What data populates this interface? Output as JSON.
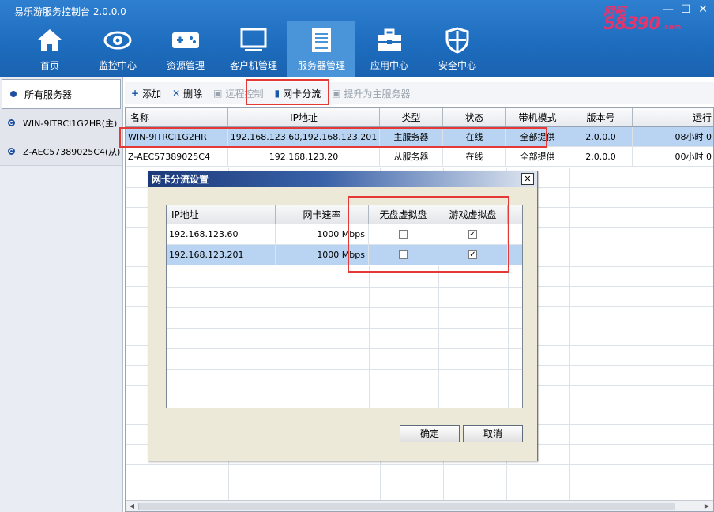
{
  "app": {
    "title": "易乐游服务控制台 2.0.0.0"
  },
  "window_controls": {
    "minimize": "—",
    "maximize": "☐",
    "close": "✕"
  },
  "watermark": {
    "top": "网吧",
    "number": "58390",
    "com": ".com"
  },
  "nav": {
    "items": [
      {
        "label": "首页",
        "icon": "home-icon"
      },
      {
        "label": "监控中心",
        "icon": "eye-icon"
      },
      {
        "label": "资源管理",
        "icon": "gamepad-icon"
      },
      {
        "label": "客户机管理",
        "icon": "monitor-icon"
      },
      {
        "label": "服务器管理",
        "icon": "server-document-icon",
        "active": true
      },
      {
        "label": "应用中心",
        "icon": "toolbox-icon"
      },
      {
        "label": "安全中心",
        "icon": "shield-icon"
      }
    ]
  },
  "sidebar": {
    "root_label": "所有服务器",
    "items": [
      {
        "label": "WIN-9ITRCI1G2HR(主)"
      },
      {
        "label": "Z-AEC57389025C4(从)"
      }
    ]
  },
  "toolbar": {
    "add": "添加",
    "delete": "删除",
    "remote": "远程控制",
    "nic_split": "网卡分流",
    "promote": "提升为主服务器"
  },
  "server_table": {
    "columns": [
      "名称",
      "IP地址",
      "类型",
      "状态",
      "带机模式",
      "版本号",
      "运行"
    ],
    "rows": [
      [
        "WIN-9ITRCI1G2HR",
        "192.168.123.60,192.168.123.201",
        "主服务器",
        "在线",
        "全部提供",
        "2.0.0.0",
        "08小时 0"
      ],
      [
        "Z-AEC57389025C4",
        "192.168.123.20",
        "从服务器",
        "在线",
        "全部提供",
        "2.0.0.0",
        "00小时 0"
      ]
    ],
    "selected_row": 0
  },
  "dialog": {
    "title": "网卡分流设置",
    "close": "✕",
    "columns": [
      "IP地址",
      "网卡速率",
      "无盘虚拟盘",
      "游戏虚拟盘"
    ],
    "rows": [
      {
        "ip": "192.168.123.60",
        "speed": "1000 Mbps",
        "diskless": false,
        "game": true
      },
      {
        "ip": "192.168.123.201",
        "speed": "1000 Mbps",
        "diskless": false,
        "game": true
      }
    ],
    "selected_row": 1,
    "ok": "确定",
    "cancel": "取消"
  },
  "colors": {
    "header_blue": "#1e6dbf",
    "active_tab": "#4a95d9",
    "selection": "#b8d4f2",
    "highlight_red": "#e53935"
  }
}
